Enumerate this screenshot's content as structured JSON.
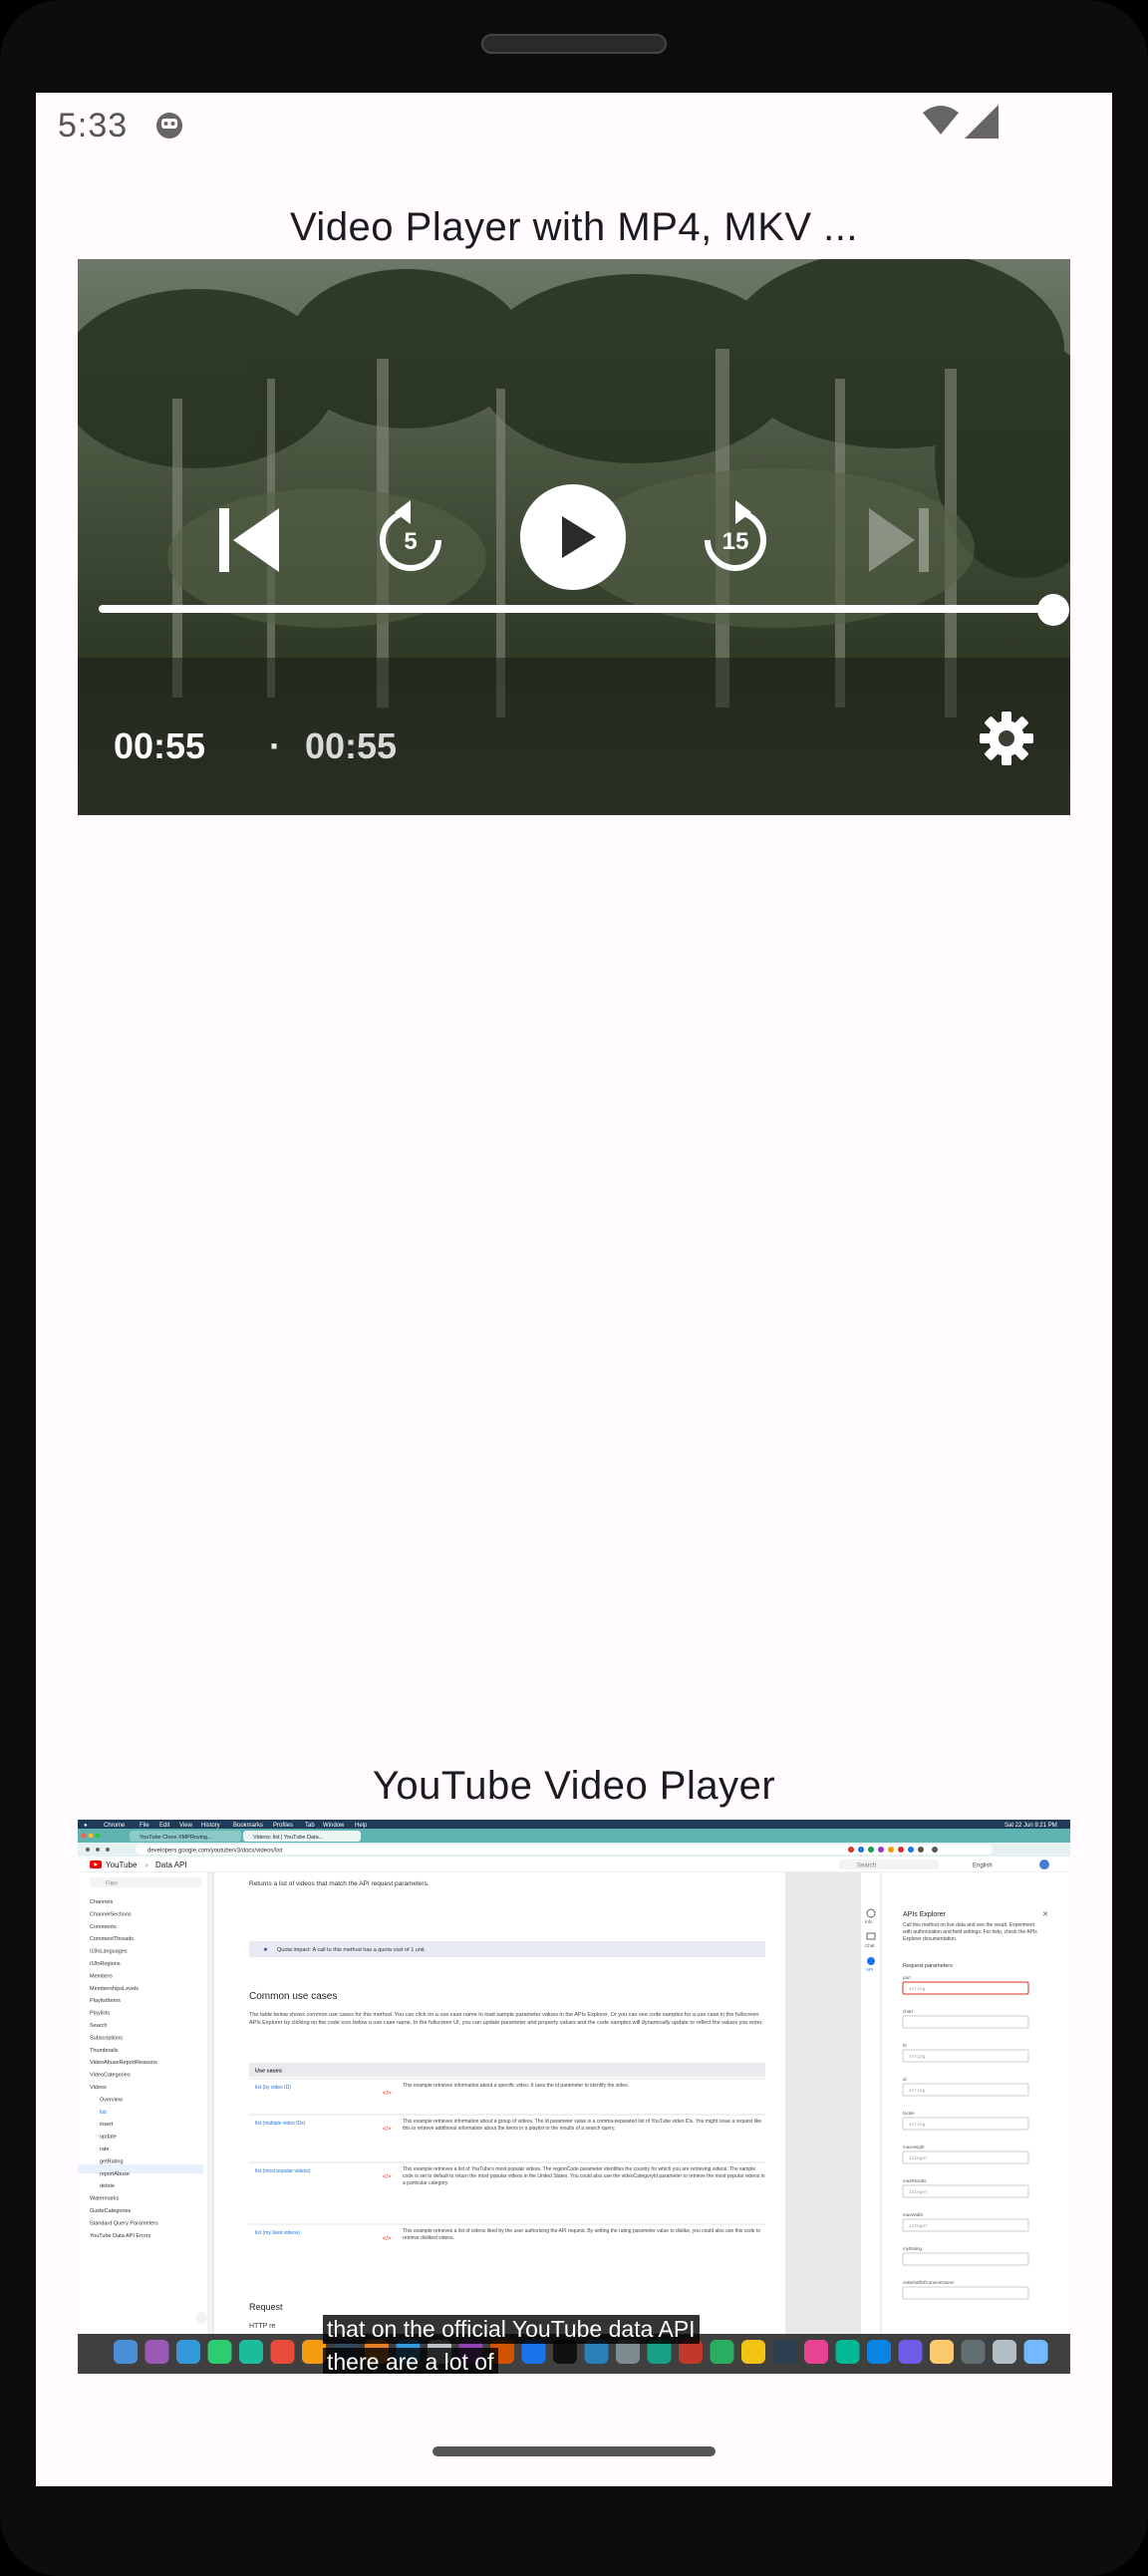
{
  "status_bar": {
    "time": "5:33"
  },
  "sections": [
    {
      "title": "Video Player with MP4, MKV ..."
    },
    {
      "title": "YouTube Video Player"
    }
  ],
  "player": {
    "current_time": "00:55",
    "separator": "·",
    "duration": "00:55",
    "progress_fraction": 1.0,
    "rewind_seconds": "5",
    "forward_seconds": "15"
  },
  "youtube_player": {
    "captions": [
      "that on the official YouTube data API",
      "there are a lot of"
    ],
    "embedded_screenshot": {
      "menu_bar": [
        "Chrome",
        "File",
        "Edit",
        "View",
        "History",
        "Bookmarks",
        "Profiles",
        "Tab",
        "Window",
        "Help"
      ],
      "menu_clock": "Sat 22 Jun 9:21 PM",
      "tabs": [
        "YouTube Clone XMPRoving...",
        "Videos: list | YouTube Data..."
      ],
      "url": "developers.google.com/youtube/v3/docs/videos/list",
      "site_name": "YouTube",
      "site_section": "Data API",
      "search_placeholder": "Search",
      "language": "English",
      "filter_placeholder": "Filter",
      "sidebar_items": [
        "Channels",
        "ChannelSections",
        "Comments",
        "CommentThreads",
        "i18nLanguages",
        "i18nRegions",
        "Members",
        "MembershipsLevels",
        "PlaylistItems",
        "Playlists",
        "Search",
        "Subscriptions",
        "Thumbnails",
        "VideoAbuseReportReasons",
        "VideoCategories",
        "Videos",
        "Overview",
        "list",
        "insert",
        "update",
        "rate",
        "getRating",
        "reportAbuse",
        "delete",
        "Watermarks",
        "GuideCategories",
        "Standard Query Parameters",
        "YouTube Data API Errors"
      ],
      "intro": "Returns a list of videos that match the API request parameters.",
      "quota_note": "Quota impact: A call to this method has a quota cost of 1 unit.",
      "heading_use_cases": "Common use cases",
      "use_cases_text": "The table below shows common use cases for this method. You can click on a use case name to load sample parameter values in the APIs Explorer. Or you can see code samples for a use case in the fullscreen APIs Explorer by clicking on the code icon below a use case name. In the fullscreen UI, you can update parameter and property values and the code samples will dynamically update to reflect the values you enter.",
      "table_header": "Use cases",
      "use_case_rows": [
        {
          "name": "list (by video ID)",
          "desc": "This example retrieves information about a specific video. It uses the id parameter to identify the video."
        },
        {
          "name": "list (multiple video IDs)",
          "desc": "This example retrieves information about a group of videos. The id parameter value is a comma-separated list of YouTube video IDs. You might issue a request like this to retrieve additional information about the items in a playlist or the results of a search query."
        },
        {
          "name": "list (most popular videos)",
          "desc": "This example retrieves a list of YouTube's most popular videos. The regionCode parameter identifies the country for which you are retrieving videos. The sample code is set to default to return the most popular videos in the United States. You could also use the videoCategoryId parameter to retrieve the most popular videos in a particular category."
        },
        {
          "name": "list (my liked videos)",
          "desc": "This example retrieves a list of videos liked by the user authorizing the API request. By setting the rating parameter value to dislike, you could also use this code to retrieve disliked videos."
        }
      ],
      "heading_request": "Request",
      "http_label": "HTTP re",
      "right_rail": [
        "Info",
        "Chat",
        "API"
      ],
      "explorer_title": "APIs Explorer",
      "explorer_desc": "Call this method on live data and see the result. Experiment with authorization and field settings. For help, check the APIs Explorer documentation.",
      "explorer_params_label": "Request parameters",
      "explorer_params": [
        {
          "name": "part",
          "type": "string"
        },
        {
          "name": "chart",
          "type": ""
        },
        {
          "name": "hl",
          "type": "string"
        },
        {
          "name": "id",
          "type": "string"
        },
        {
          "name": "locale",
          "type": "string"
        },
        {
          "name": "maxHeight",
          "type": "integer"
        },
        {
          "name": "maxResults",
          "type": "integer"
        },
        {
          "name": "maxWidth",
          "type": "integer"
        },
        {
          "name": "myRating",
          "type": ""
        },
        {
          "name": "onBehalfOfContentOwner",
          "type": ""
        }
      ]
    }
  },
  "colors": {
    "screen_bg": "#fffbfe",
    "title_text": "#1b1b1f",
    "teal_browser": "#5fb3b0",
    "link_blue": "#1a73e8",
    "error_red": "#d93025"
  }
}
